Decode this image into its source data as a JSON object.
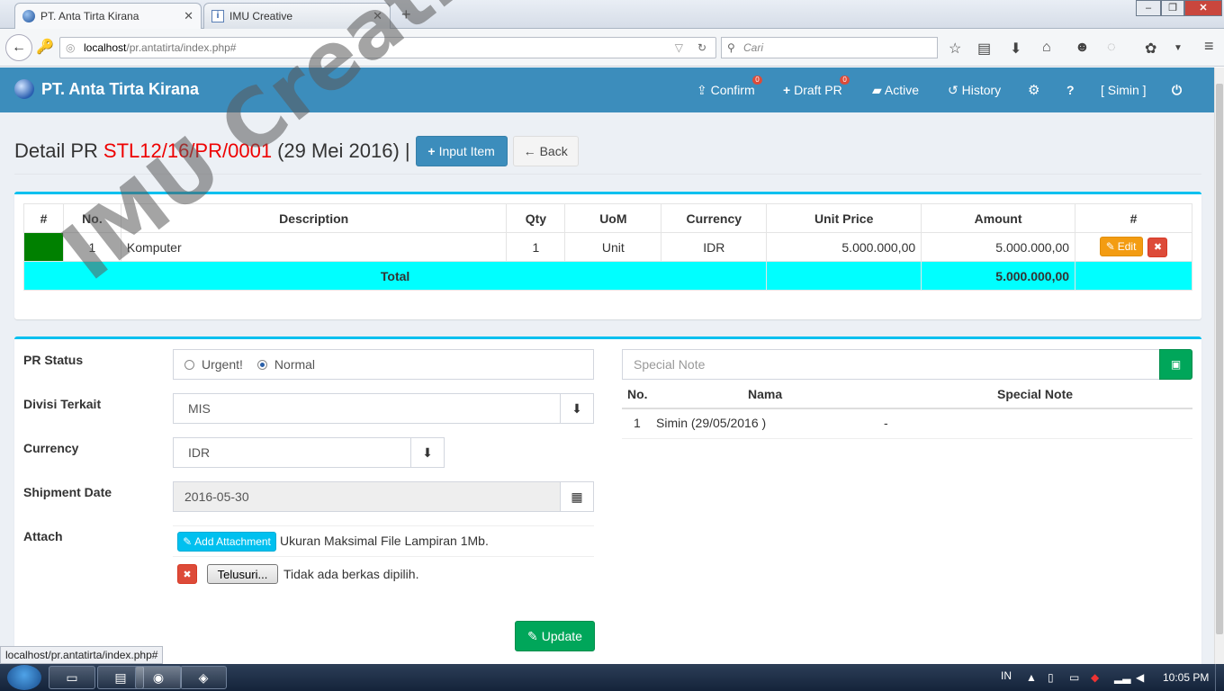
{
  "browser": {
    "tabs": [
      {
        "title": "PT. Anta Tirta Kirana",
        "active": true
      },
      {
        "title": "IMU Creative",
        "active": false
      }
    ],
    "url_host": "localhost",
    "url_path": "/pr.antatirta/index.php#",
    "search_placeholder": "Cari",
    "status_url": "localhost/pr.antatirta/index.php#"
  },
  "header": {
    "brand": "PT. Anta Tirta Kirana",
    "menu": {
      "confirm": "Confirm",
      "confirm_badge": "0",
      "draft": "Draft PR",
      "draft_badge": "0",
      "active": "Active",
      "history": "History",
      "help": "?",
      "user": "[ Simin ]"
    }
  },
  "page": {
    "title_prefix": "Detail PR",
    "pr_code": "STL12/16/PR/0001",
    "title_date": "(29 Mei 2016) |",
    "input_item_label": "Input Item",
    "back_label": "Back"
  },
  "items_table": {
    "headers": [
      "#",
      "No.",
      "Description",
      "Qty",
      "UoM",
      "Currency",
      "Unit Price",
      "Amount",
      "#"
    ],
    "rows": [
      {
        "no": "1",
        "description": "Komputer",
        "qty": "1",
        "uom": "Unit",
        "currency": "IDR",
        "unit_price": "5.000.000,00",
        "amount": "5.000.000,00",
        "status_color": "#008000"
      }
    ],
    "total_label": "Total",
    "total_amount": "5.000.000,00",
    "edit_label": "Edit"
  },
  "form": {
    "pr_status_label": "PR Status",
    "status_options": [
      "Urgent!",
      "Normal"
    ],
    "status_selected": "Normal",
    "divisi_label": "Divisi Terkait",
    "divisi_value": "MIS",
    "currency_label": "Currency",
    "currency_value": "IDR",
    "shipment_label": "Shipment Date",
    "shipment_value": "2016-05-30",
    "attach_label": "Attach",
    "add_attachment_label": "Add Attachment",
    "attachment_note": "Ukuran Maksimal File Lampiran 1Mb.",
    "browse_label": "Telusuri...",
    "no_file_text": "Tidak ada berkas dipilih.",
    "update_label": "Update"
  },
  "notes": {
    "placeholder": "Special Note",
    "headers": [
      "No.",
      "Nama",
      "Special Note"
    ],
    "rows": [
      {
        "no": "1",
        "nama": "Simin (29/05/2016 )",
        "note": "-"
      }
    ]
  },
  "watermark": "IMU Creative",
  "taskbar": {
    "lang": "IN",
    "time": "10:05 PM"
  },
  "colors": {
    "header": "#3c8dbc",
    "accent": "#00c0ef",
    "pr_code": "#ee0000",
    "total_row": "#00ffff"
  }
}
